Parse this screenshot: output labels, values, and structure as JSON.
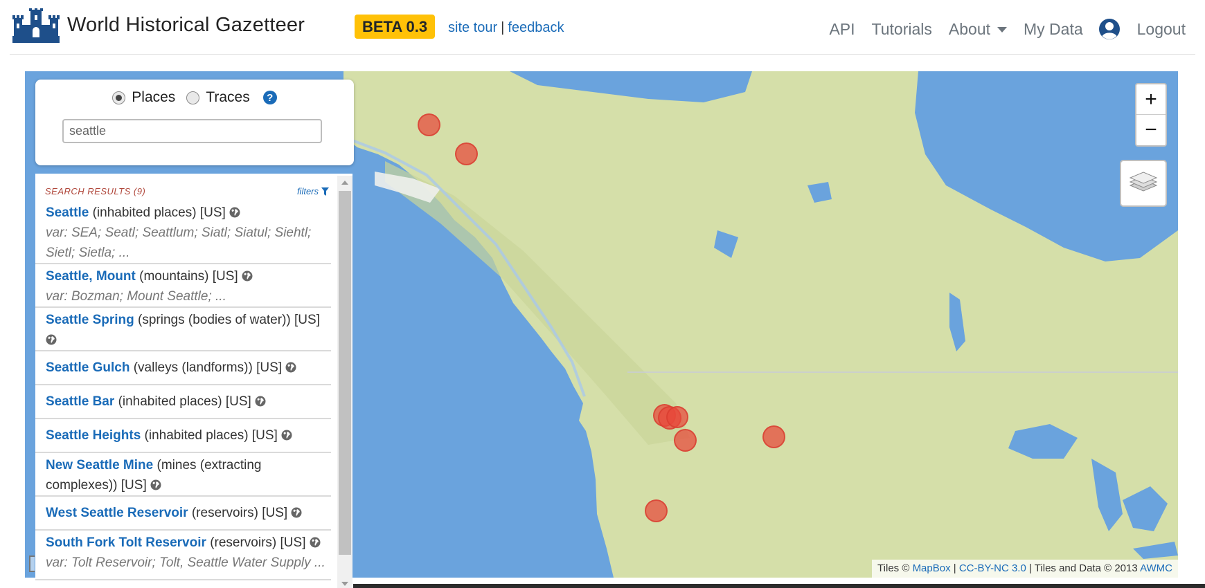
{
  "navbar": {
    "brand": "World Historical Gazetteer",
    "beta": "BETA 0.3",
    "site_tour": "site tour",
    "separator": "|",
    "feedback": "feedback",
    "api": "API",
    "tutorials": "Tutorials",
    "about": "About",
    "my_data": "My Data",
    "logout": "Logout"
  },
  "search": {
    "mode_places": "Places",
    "mode_traces": "Traces",
    "selected_mode": "Places",
    "help": "?",
    "query": "seattle"
  },
  "results": {
    "header": "SEARCH RESULTS (9)",
    "filters": "filters",
    "items": [
      {
        "name": "Seattle",
        "type": "(inhabited places)",
        "cc": "[US]",
        "var": "var: SEA; Seatl; Seattlum; Siatl; Siatul; Siehtl; Sietl; Sietla; ..."
      },
      {
        "name": "Seattle, Mount",
        "type": "(mountains)",
        "cc": "[US]",
        "var": "var: Bozman; Mount Seattle; ..."
      },
      {
        "name": "Seattle Spring",
        "type": "(springs (bodies of water))",
        "cc": "[US]",
        "var": ""
      },
      {
        "name": "Seattle Gulch",
        "type": "(valleys (landforms))",
        "cc": "[US]",
        "var": ""
      },
      {
        "name": "Seattle Bar",
        "type": "(inhabited places)",
        "cc": "[US]",
        "var": ""
      },
      {
        "name": "Seattle Heights",
        "type": "(inhabited places)",
        "cc": "[US]",
        "var": ""
      },
      {
        "name": "New Seattle Mine",
        "type": "(mines (extracting complexes))",
        "cc": "[US]",
        "var": ""
      },
      {
        "name": "West Seattle Reservoir",
        "type": "(reservoirs)",
        "cc": "[US]",
        "var": ""
      },
      {
        "name": "South Fork Tolt Reservoir",
        "type": "(reservoirs)",
        "cc": "[US]",
        "var": "var: Tolt Reservoir; Tolt, Seattle Water Supply ..."
      }
    ]
  },
  "map": {
    "zoom_in": "+",
    "zoom_out": "−",
    "attribution": {
      "tiles": "Tiles ©",
      "mapbox": "MapBox",
      "sep1": "|",
      "license": "CC-BY-NC 3.0",
      "data": "| Tiles and Data © 2013",
      "awmc": "AWMC"
    },
    "colors": {
      "ocean": "#6aa3dd",
      "land": "#d5dfa9",
      "marker": "#e8483a"
    }
  },
  "icons": [
    "logo-castle-icon",
    "user-icon",
    "help-icon",
    "globe-icon",
    "filter-icon",
    "layers-icon"
  ]
}
